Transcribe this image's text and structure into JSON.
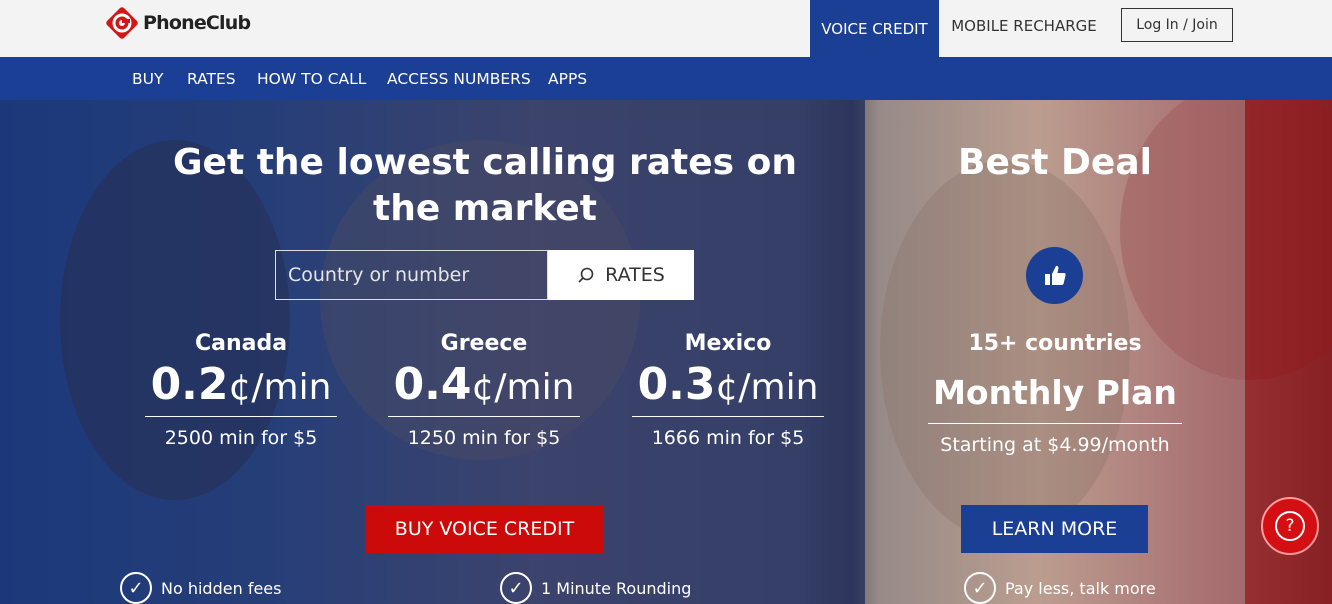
{
  "brand": {
    "name": "PhoneClub"
  },
  "topbar": {
    "tabs": [
      {
        "label": "VOICE CREDIT",
        "active": true
      },
      {
        "label": "MOBILE RECHARGE",
        "active": false
      }
    ],
    "login_label": "Log In / Join"
  },
  "nav": {
    "items": [
      {
        "label": "BUY"
      },
      {
        "label": "RATES"
      },
      {
        "label": "HOW TO CALL"
      },
      {
        "label": "ACCESS NUMBERS"
      },
      {
        "label": "APPS"
      }
    ]
  },
  "hero": {
    "headline": "Get the lowest calling rates on the market",
    "search": {
      "placeholder": "Country or number",
      "button_label": "RATES"
    },
    "rates": [
      {
        "country": "Canada",
        "price": "0.2",
        "unit": "¢/min",
        "note": "2500 min for $5"
      },
      {
        "country": "Greece",
        "price": "0.4",
        "unit": "¢/min",
        "note": "1250 min for $5"
      },
      {
        "country": "Mexico",
        "price": "0.3",
        "unit": "¢/min",
        "note": "1666 min for $5"
      }
    ],
    "buy_button": "BUY VOICE CREDIT",
    "features": [
      {
        "label": "No hidden fees"
      },
      {
        "label": "1 Minute Rounding"
      },
      {
        "label": "Pay less, talk more"
      }
    ]
  },
  "deal": {
    "title": "Best Deal",
    "icon": "thumbs-up-icon",
    "countries": "15+ countries",
    "plan": "Monthly Plan",
    "note": "Starting at $4.99/month",
    "button": "LEARN MORE"
  },
  "help": {
    "icon": "question-icon",
    "glyph": "?"
  },
  "colors": {
    "brand_blue": "#1a3f94",
    "accent_red": "#cc0a0a"
  }
}
